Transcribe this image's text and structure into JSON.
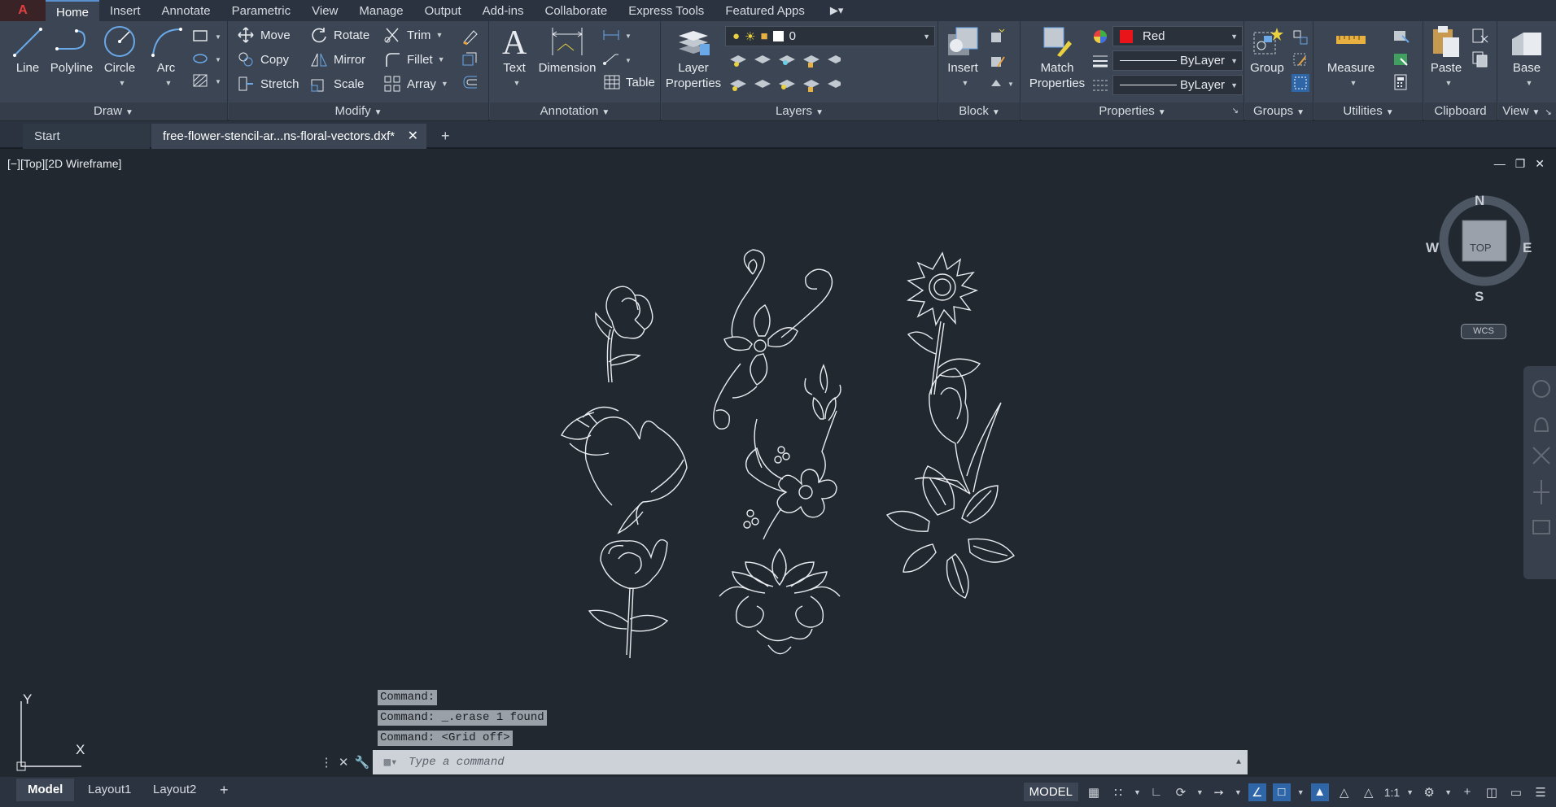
{
  "menu": {
    "tabs": [
      "Home",
      "Insert",
      "Annotate",
      "Parametric",
      "View",
      "Manage",
      "Output",
      "Add-ins",
      "Collaborate",
      "Express Tools",
      "Featured Apps"
    ],
    "active": "Home"
  },
  "ribbon": {
    "draw": {
      "title": "Draw",
      "line": "Line",
      "polyline": "Polyline",
      "circle": "Circle",
      "arc": "Arc"
    },
    "modify": {
      "title": "Modify",
      "move": "Move",
      "copy": "Copy",
      "stretch": "Stretch",
      "rotate": "Rotate",
      "mirror": "Mirror",
      "scale": "Scale",
      "trim": "Trim",
      "fillet": "Fillet",
      "array": "Array"
    },
    "annotation": {
      "title": "Annotation",
      "text": "Text",
      "dimension": "Dimension",
      "table": "Table"
    },
    "layers": {
      "title": "Layers",
      "layer_properties_1": "Layer",
      "layer_properties_2": "Properties",
      "current_layer": "0"
    },
    "block": {
      "title": "Block",
      "insert": "Insert"
    },
    "properties": {
      "title": "Properties",
      "match_1": "Match",
      "match_2": "Properties",
      "color": "Red",
      "color_hex": "#e8141a",
      "linetype": "ByLayer",
      "lineweight": "ByLayer"
    },
    "groups": {
      "title": "Groups",
      "group": "Group"
    },
    "utilities": {
      "title": "Utilities",
      "measure": "Measure"
    },
    "clipboard": {
      "title": "Clipboard",
      "paste": "Paste"
    },
    "view": {
      "title": "View",
      "base": "Base"
    }
  },
  "documents": {
    "start_tab": "Start",
    "file_tab": "free-flower-stencil-ar...ns-floral-vectors.dxf*"
  },
  "viewport": {
    "label": "[−][Top][2D Wireframe]",
    "viewcube": {
      "n": "N",
      "s": "S",
      "e": "E",
      "w": "W",
      "face": "TOP"
    },
    "wcs": "WCS",
    "ucs_x": "X",
    "ucs_y": "Y"
  },
  "command": {
    "history": [
      "Command:",
      "Command: _.erase 1 found",
      "Command:  <Grid off>"
    ],
    "placeholder": "Type a command"
  },
  "status": {
    "layouts": [
      "Model",
      "Layout1",
      "Layout2"
    ],
    "space": "MODEL",
    "scale": "1:1"
  },
  "colors": {
    "accent": "#2f66a8",
    "background": "#212830",
    "ribbon": "#3b4553"
  }
}
